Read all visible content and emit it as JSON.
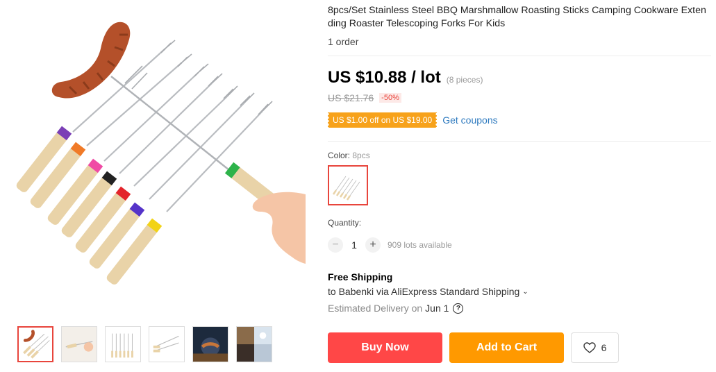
{
  "product": {
    "title": "8pcs/Set Stainless Steel BBQ Marshmallow Roasting Sticks Camping Cookware Extending Roaster Telescoping Forks For Kids",
    "orders": "1 order"
  },
  "pricing": {
    "price": "US $10.88 / lot",
    "pieces": "(8 pieces)",
    "old_price": "US $21.76",
    "discount": "-50%",
    "coupon": "US $1.00 off on US $19.00",
    "get_coupons": "Get coupons"
  },
  "color": {
    "label": "Color: ",
    "value": "8pcs"
  },
  "quantity": {
    "label": "Quantity:",
    "minus": "−",
    "value": "1",
    "plus": "+",
    "available": "909 lots available"
  },
  "shipping": {
    "title": "Free Shipping",
    "detail": "to Babenki via AliExpress Standard Shipping",
    "delivery_label": "Estimated Delivery on",
    "delivery_date": "Jun 1",
    "help": "?"
  },
  "actions": {
    "buy_now": "Buy Now",
    "add_to_cart": "Add to Cart",
    "wishlist_count": "6"
  },
  "icons": [
    "chevron-down-icon",
    "help-icon",
    "heart-icon"
  ],
  "colors": {
    "accent_red": "#ff4747",
    "accent_orange": "#ff9900",
    "coupon": "#f7a21b",
    "link": "#2e7abf"
  }
}
